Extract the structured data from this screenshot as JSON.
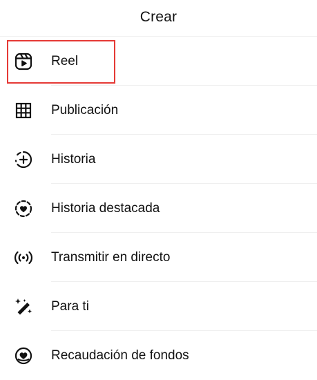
{
  "header": {
    "title": "Crear"
  },
  "menu": {
    "items": [
      {
        "label": "Reel",
        "icon": "reels-icon"
      },
      {
        "label": "Publicación",
        "icon": "grid-icon"
      },
      {
        "label": "Historia",
        "icon": "story-add-icon"
      },
      {
        "label": "Historia destacada",
        "icon": "highlight-heart-icon"
      },
      {
        "label": "Transmitir en directo",
        "icon": "live-broadcast-icon"
      },
      {
        "label": "Para ti",
        "icon": "magic-wand-icon"
      },
      {
        "label": "Recaudación de fondos",
        "icon": "fundraiser-heart-icon"
      }
    ]
  },
  "colors": {
    "text": "#111111",
    "divider": "#efefef",
    "highlight_border": "#e53935",
    "background": "#ffffff"
  }
}
